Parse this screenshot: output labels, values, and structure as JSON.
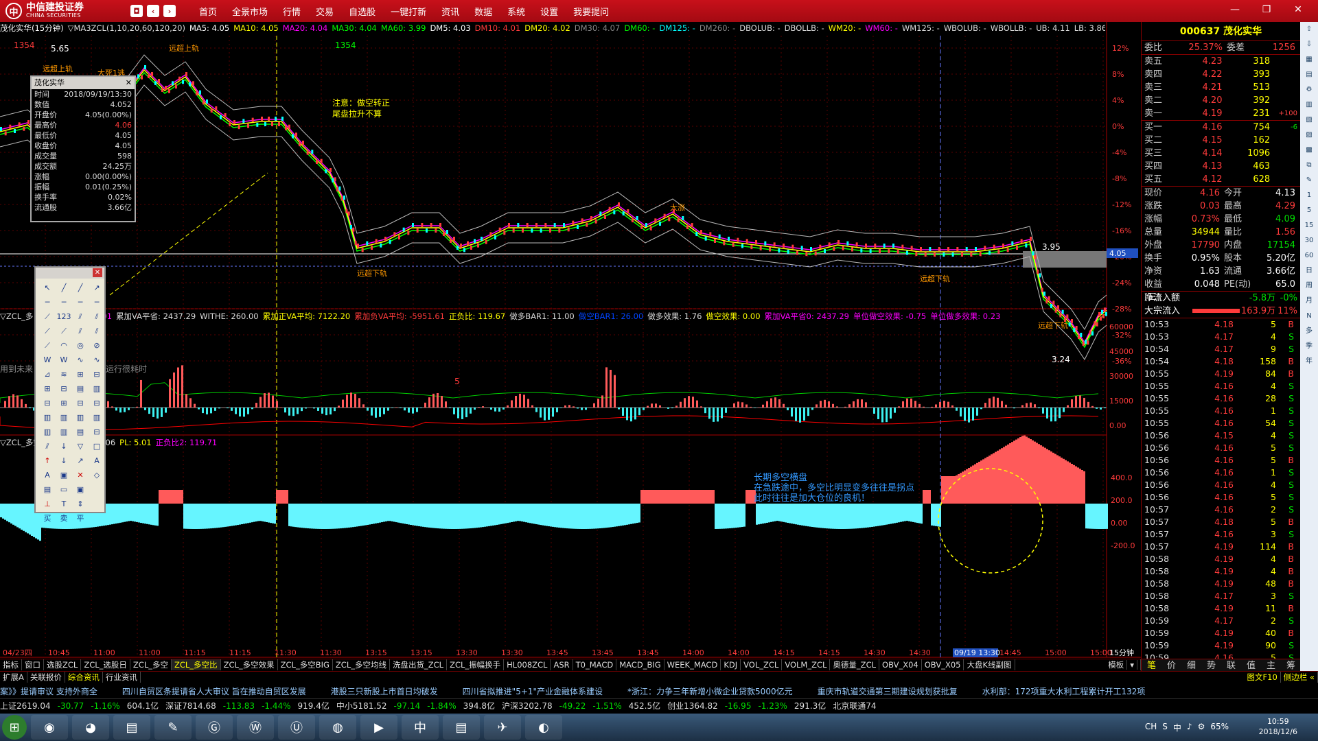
{
  "app": {
    "logo_main": "中信建投证券",
    "logo_sub": "CHINA SECURITIES",
    "menu": [
      "首页",
      "全景市场",
      "行情",
      "交易",
      "自选股",
      "一键打新",
      "资讯",
      "数据",
      "系统",
      "设置",
      "我要提问"
    ],
    "window_controls": [
      "—",
      "❐",
      "✕"
    ]
  },
  "main_chart": {
    "title_bar": [
      {
        "text": "茂化实华(15分钟)",
        "color": "#ffffff"
      },
      {
        "text": "▽MA3ZCL(1,10,20,60,120,20)",
        "color": "#dddddd"
      },
      {
        "text": "MA5: 4.05",
        "color": "#ffffff"
      },
      {
        "text": "MA10: 4.05",
        "color": "#ffff00"
      },
      {
        "text": "MA20: 4.04",
        "color": "#ff00ff"
      },
      {
        "text": "MA30: 4.04",
        "color": "#00ff00"
      },
      {
        "text": "MA60: 3.99",
        "color": "#00ff00"
      },
      {
        "text": "DM5: 4.03",
        "color": "#ffffff"
      },
      {
        "text": "DM10: 4.01",
        "color": "#ff3b3b"
      },
      {
        "text": "DM20: 4.02",
        "color": "#ffff00"
      },
      {
        "text": "DM30: 4.07",
        "color": "#888888"
      },
      {
        "text": "DM60: -",
        "color": "#00ff00"
      },
      {
        "text": "DM125: -",
        "color": "#00ffff"
      },
      {
        "text": "DM260: -",
        "color": "#888888"
      },
      {
        "text": "DBOLUB: -",
        "color": "#dddddd"
      },
      {
        "text": "DBOLLB: -",
        "color": "#dddddd"
      },
      {
        "text": "WM20: -",
        "color": "#ffff00"
      },
      {
        "text": "WM60: -",
        "color": "#ff00ff"
      },
      {
        "text": "WM125: -",
        "color": "#dddddd"
      },
      {
        "text": "WBOLUB: -",
        "color": "#dddddd"
      },
      {
        "text": "WBOLLB: -",
        "color": "#dddddd"
      },
      {
        "text": "UB: 4.11",
        "color": "#dddddd"
      },
      {
        "text": "LB: 3.86",
        "color": "#dddddd"
      },
      {
        "text": "远超上轨应",
        "color": "#ffff00"
      }
    ],
    "y_axis_pct": [
      "12%",
      "8%",
      "4%",
      "0%",
      "-4%",
      "-8%",
      "-12%",
      "-16%",
      "-20%",
      "-24%",
      "-28%",
      "-32%",
      "-36%"
    ],
    "price_labels": {
      "high": "5.65",
      "low": "3.24",
      "right_mark": "3.95",
      "current": "4.05",
      "count1": "1354",
      "count2": "1354"
    },
    "annotations": {
      "note1": "注意：做空转正",
      "note2": "尾盘拉升不算",
      "overlay_left": "用到未来",
      "overlay_right": "运行很耗时",
      "marker": "5"
    },
    "signal_labels": [
      "远超上轨",
      "远超上轨",
      "大死1逃",
      "远超下轨",
      "远超下轨",
      "大涨",
      "远超下轨"
    ]
  },
  "indicator1": {
    "title_bar": [
      {
        "text": "▽ZCL_多",
        "color": "#dddddd"
      },
      {
        "text": "均价: 4.06",
        "color": "#ffff00"
      },
      {
        "text": "PL: 5.01",
        "color": "#ff00ff"
      },
      {
        "text": "累加VA平省: 2437.29",
        "color": "#dddddd"
      },
      {
        "text": "WITHE: 260.00",
        "color": "#dddddd"
      },
      {
        "text": "累加正VA平均: 7122.20",
        "color": "#ffff00"
      },
      {
        "text": "累加负VA平均: -5951.61",
        "color": "#ff3b3b"
      },
      {
        "text": "正负比: 119.67",
        "color": "#ffff00"
      },
      {
        "text": "做多BAR1: 11.00",
        "color": "#dddddd"
      },
      {
        "text": "做空BAR1: 26.00",
        "color": "#0044ff"
      },
      {
        "text": "做多效果: 1.76",
        "color": "#dddddd"
      },
      {
        "text": "做空效果: 0.00",
        "color": "#ffff00"
      },
      {
        "text": "累加VA平省0: 2437.29",
        "color": "#ff00ff"
      },
      {
        "text": "单位做空效果: -0.75",
        "color": "#ff00ff"
      },
      {
        "text": "单位做多效果: 0.23",
        "color": "#ff00ff"
      }
    ],
    "y_axis": [
      "60000",
      "45000",
      "30000",
      "15000",
      "0.00"
    ]
  },
  "indicator2": {
    "title_bar": [
      {
        "text": "▽ZCL_多空比(1,10)",
        "color": "#dddddd"
      },
      {
        "text": "均价: 4.06",
        "color": "#dddddd"
      },
      {
        "text": "PL: 5.01",
        "color": "#ffff00"
      },
      {
        "text": "正负比2: 119.71",
        "color": "#ff00ff"
      }
    ],
    "y_axis": [
      "400.0",
      "200.0",
      "0.00",
      "-200.0"
    ],
    "note_lines": [
      "长期多空横盘",
      "在急跌途中，多空比明显变多往往是拐点",
      "此时往往是加大仓位的良机！"
    ]
  },
  "time_axis": [
    "04/23四",
    "10:45",
    "11:00",
    "11:00",
    "11:15",
    "11:15",
    "11:30",
    "11:30",
    "13:15",
    "13:15",
    "13:30",
    "13:30",
    "13:45",
    "13:45",
    "13:45",
    "14:00",
    "14:00",
    "14:15",
    "14:15",
    "14:30",
    "14:30",
    "09/19 13:30",
    "14:45",
    "15:00",
    "15:00"
  ],
  "period_label": "15分钟",
  "infowin": {
    "title": "茂化实华",
    "rows": [
      {
        "k": "时间",
        "v": "2018/09/19/13:30",
        "color": "#dddddd"
      },
      {
        "k": "数值",
        "v": "4.052",
        "color": "#dddddd"
      },
      {
        "k": "开盘价",
        "v": "4.05(0.00%)",
        "color": "#dddddd"
      },
      {
        "k": "最高价",
        "v": "4.06",
        "color": "#ff3b3b"
      },
      {
        "k": "最低价",
        "v": "4.05",
        "color": "#dddddd"
      },
      {
        "k": "收盘价",
        "v": "4.05",
        "color": "#dddddd"
      },
      {
        "k": "成交量",
        "v": "598",
        "color": "#dddddd"
      },
      {
        "k": "成交额",
        "v": "24.25万",
        "color": "#dddddd"
      },
      {
        "k": "涨幅",
        "v": "0.00(0.00%)",
        "color": "#dddddd"
      },
      {
        "k": "振幅",
        "v": "0.01(0.25%)",
        "color": "#dddddd"
      },
      {
        "k": "换手率",
        "v": "0.02%",
        "color": "#dddddd"
      },
      {
        "k": "流通股",
        "v": "3.66亿",
        "color": "#dddddd"
      }
    ]
  },
  "toolwin": {
    "tools": [
      "↖",
      "╱",
      "╱",
      "↗",
      "─",
      "─",
      "─",
      "─",
      "⟋",
      "123",
      "⫽",
      "⫽",
      "⟋",
      "⟋",
      "⫽",
      "⫽",
      "⟋",
      "◠",
      "◎",
      "⊘",
      "W",
      "W",
      "∿",
      "∿",
      "⊿",
      "≋",
      "⊞",
      "⊟",
      "⊞",
      "⊟",
      "▤",
      "▥",
      "⊟",
      "⊞",
      "⊟",
      "⊟",
      "▥",
      "▥",
      "▥",
      "▥",
      "▥",
      "▥",
      "▤",
      "⊟",
      "⫽",
      "↓",
      "▽",
      "□",
      "↑",
      "↓",
      "↗",
      "A",
      "A",
      "▣",
      "✕",
      "◇",
      "▤",
      "▭",
      "▣",
      "",
      "⊥",
      "T",
      "⇕",
      "",
      "买",
      "卖",
      "平",
      ""
    ]
  },
  "quote": {
    "code_name": "000637 茂化实华",
    "weibi": {
      "label": "委比",
      "pct": "25.37%",
      "diff_label": "委差",
      "diff": "1256"
    },
    "asks": [
      {
        "label": "卖五",
        "price": "4.23",
        "vol": "318",
        "extra": ""
      },
      {
        "label": "卖四",
        "price": "4.22",
        "vol": "393",
        "extra": ""
      },
      {
        "label": "卖三",
        "price": "4.21",
        "vol": "513",
        "extra": ""
      },
      {
        "label": "卖二",
        "price": "4.20",
        "vol": "392",
        "extra": ""
      },
      {
        "label": "卖一",
        "price": "4.19",
        "vol": "231",
        "extra": "+100"
      }
    ],
    "bids": [
      {
        "label": "买一",
        "price": "4.16",
        "vol": "754",
        "extra": "-6"
      },
      {
        "label": "买二",
        "price": "4.15",
        "vol": "162",
        "extra": ""
      },
      {
        "label": "买三",
        "price": "4.14",
        "vol": "1096",
        "extra": ""
      },
      {
        "label": "买四",
        "price": "4.13",
        "vol": "463",
        "extra": ""
      },
      {
        "label": "买五",
        "price": "4.12",
        "vol": "628",
        "extra": ""
      }
    ],
    "stats": [
      {
        "a": "现价",
        "b": "4.16",
        "bc": "#ff3b3b",
        "c": "今开",
        "d": "4.13",
        "dc": "#ffffff"
      },
      {
        "a": "涨跌",
        "b": "0.03",
        "bc": "#ff3b3b",
        "c": "最高",
        "d": "4.29",
        "dc": "#ff3b3b"
      },
      {
        "a": "涨幅",
        "b": "0.73%",
        "bc": "#ff3b3b",
        "c": "最低",
        "d": "4.09",
        "dc": "#00e000"
      },
      {
        "a": "总量",
        "b": "34944",
        "bc": "#ffff00",
        "c": "量比",
        "d": "1.56",
        "dc": "#ff3b3b"
      },
      {
        "a": "外盘",
        "b": "17790",
        "bc": "#ff3b3b",
        "c": "内盘",
        "d": "17154",
        "dc": "#00e000"
      },
      {
        "a": "换手",
        "b": "0.95%",
        "bc": "#ffffff",
        "c": "股本",
        "d": "5.20亿",
        "dc": "#ffffff"
      },
      {
        "a": "净资",
        "b": "1.63",
        "bc": "#ffffff",
        "c": "流通",
        "d": "3.66亿",
        "dc": "#ffffff"
      },
      {
        "a": "收益(三)",
        "b": "0.048",
        "bc": "#ffffff",
        "c": "PE(动)",
        "d": "65.0",
        "dc": "#ffffff"
      }
    ],
    "flow": [
      {
        "label": "净流入额",
        "value": "-5.8万",
        "pct": "-0%",
        "vc": "#00e000"
      },
      {
        "label": "大宗流入",
        "value": "163.9万",
        "pct": "11%",
        "vc": "#ff3b3b"
      }
    ],
    "ticks": [
      {
        "t": "10:53",
        "p": "4.18",
        "pc": "#ff3b3b",
        "v": "5",
        "s": "B",
        "sc": "#ff3b3b"
      },
      {
        "t": "10:53",
        "p": "4.17",
        "pc": "#ff3b3b",
        "v": "4",
        "s": "S",
        "sc": "#00e000"
      },
      {
        "t": "10:54",
        "p": "4.17",
        "pc": "#ff3b3b",
        "v": "9",
        "s": "S",
        "sc": "#00e000"
      },
      {
        "t": "10:54",
        "p": "4.18",
        "pc": "#ff3b3b",
        "v": "158",
        "s": "B",
        "sc": "#ff3b3b"
      },
      {
        "t": "10:55",
        "p": "4.19",
        "pc": "#ff3b3b",
        "v": "84",
        "s": "B",
        "sc": "#ff3b3b"
      },
      {
        "t": "10:55",
        "p": "4.16",
        "pc": "#ff3b3b",
        "v": "4",
        "s": "S",
        "sc": "#00e000"
      },
      {
        "t": "10:55",
        "p": "4.16",
        "pc": "#ff3b3b",
        "v": "28",
        "s": "S",
        "sc": "#00e000"
      },
      {
        "t": "10:55",
        "p": "4.16",
        "pc": "#ff3b3b",
        "v": "1",
        "s": "S",
        "sc": "#00e000"
      },
      {
        "t": "10:55",
        "p": "4.16",
        "pc": "#ff3b3b",
        "v": "54",
        "s": "S",
        "sc": "#00e000"
      },
      {
        "t": "10:56",
        "p": "4.15",
        "pc": "#ff3b3b",
        "v": "4",
        "s": "S",
        "sc": "#00e000"
      },
      {
        "t": "10:56",
        "p": "4.16",
        "pc": "#ff3b3b",
        "v": "5",
        "s": "S",
        "sc": "#00e000"
      },
      {
        "t": "10:56",
        "p": "4.16",
        "pc": "#ff3b3b",
        "v": "5",
        "s": "B",
        "sc": "#ff3b3b"
      },
      {
        "t": "10:56",
        "p": "4.16",
        "pc": "#ff3b3b",
        "v": "1",
        "s": "S",
        "sc": "#00e000"
      },
      {
        "t": "10:56",
        "p": "4.16",
        "pc": "#ff3b3b",
        "v": "4",
        "s": "S",
        "sc": "#00e000"
      },
      {
        "t": "10:56",
        "p": "4.16",
        "pc": "#ff3b3b",
        "v": "5",
        "s": "S",
        "sc": "#00e000"
      },
      {
        "t": "10:57",
        "p": "4.16",
        "pc": "#ff3b3b",
        "v": "2",
        "s": "S",
        "sc": "#00e000"
      },
      {
        "t": "10:57",
        "p": "4.18",
        "pc": "#ff3b3b",
        "v": "5",
        "s": "B",
        "sc": "#ff3b3b"
      },
      {
        "t": "10:57",
        "p": "4.16",
        "pc": "#ff3b3b",
        "v": "3",
        "s": "S",
        "sc": "#00e000"
      },
      {
        "t": "10:57",
        "p": "4.19",
        "pc": "#ff3b3b",
        "v": "114",
        "s": "B",
        "sc": "#ff3b3b"
      },
      {
        "t": "10:58",
        "p": "4.19",
        "pc": "#ff3b3b",
        "v": "4",
        "s": "B",
        "sc": "#ff3b3b"
      },
      {
        "t": "10:58",
        "p": "4.19",
        "pc": "#ff3b3b",
        "v": "4",
        "s": "B",
        "sc": "#ff3b3b"
      },
      {
        "t": "10:58",
        "p": "4.19",
        "pc": "#ff3b3b",
        "v": "48",
        "s": "B",
        "sc": "#ff3b3b"
      },
      {
        "t": "10:58",
        "p": "4.17",
        "pc": "#ff3b3b",
        "v": "3",
        "s": "S",
        "sc": "#00e000"
      },
      {
        "t": "10:58",
        "p": "4.19",
        "pc": "#ff3b3b",
        "v": "11",
        "s": "B",
        "sc": "#ff3b3b"
      },
      {
        "t": "10:59",
        "p": "4.17",
        "pc": "#ff3b3b",
        "v": "2",
        "s": "S",
        "sc": "#00e000"
      },
      {
        "t": "10:59",
        "p": "4.19",
        "pc": "#ff3b3b",
        "v": "40",
        "s": "B",
        "sc": "#ff3b3b"
      },
      {
        "t": "10:59",
        "p": "4.19",
        "pc": "#ff3b3b",
        "v": "90",
        "s": "S",
        "sc": "#00e000"
      },
      {
        "t": "10:59",
        "p": "4.16",
        "pc": "#ff3b3b",
        "v": "5",
        "s": "S",
        "sc": "#00e000"
      }
    ],
    "bottom_tabs": [
      "笔",
      "价",
      "细",
      "势",
      "联",
      "值",
      "主",
      "筹"
    ]
  },
  "icon_strip": [
    "⇧",
    "⇩",
    "▦",
    "▤",
    "⚙",
    "▥",
    "▧",
    "▨",
    "▩",
    "⧉",
    "✎",
    "1",
    "5",
    "15",
    "30",
    "60",
    "日",
    "周",
    "月",
    "N",
    "多",
    "季",
    "年"
  ],
  "tabs_row1": [
    "指标",
    "窗口",
    "选股ZCL",
    "ZCL_选股日",
    "ZCL_多空",
    "ZCL_多空比",
    "ZCL_多空效果",
    "ZCL_多空BIG",
    "ZCL_多空均线",
    "洗盘出货_ZCL",
    "ZCL_振幅换手",
    "HL008ZCL",
    "ASR",
    "T0_MACD",
    "MACD_BIG",
    "WEEK_MACD",
    "KDJ",
    "VOL_ZCL",
    "VOLM_ZCL",
    "奥德量_ZCL",
    "OBV_X04",
    "OBV_X05",
    "大盘K线副图"
  ],
  "tabs_row1_active": "ZCL_多空比",
  "tabs_row1_right": [
    "模板",
    "▾"
  ],
  "tabs_row2": [
    "扩展A",
    "关联报价",
    "综合资讯",
    "行业资讯"
  ],
  "tabs_row2_right": [
    "图文F10",
    "侧边栏 «"
  ],
  "news": [
    "案》》提请审议 支持外商全",
    "四川自贸区条提请省人大审议 旨在推动自贸区发展",
    "港股三只新股上市首日均破发",
    "四川省拟推进\"5+1\"产业金融体系建设",
    "*浙江：力争三年新增小微企业贷款5000亿元",
    "重庆市轨道交通第三期建设规划获批复",
    "水利部：172项重大水利工程累计开工132项"
  ],
  "indices": [
    {
      "text": "上证2619.04",
      "color": "#dddddd"
    },
    {
      "text": "-30.77",
      "color": "#00e000"
    },
    {
      "text": "-1.16%",
      "color": "#00e000"
    },
    {
      "text": "604.1亿",
      "color": "#dddddd"
    },
    {
      "text": "深证7814.68",
      "color": "#dddddd"
    },
    {
      "text": "-113.83",
      "color": "#00e000"
    },
    {
      "text": "-1.44%",
      "color": "#00e000"
    },
    {
      "text": "919.4亿",
      "color": "#dddddd"
    },
    {
      "text": "中小5181.52",
      "color": "#dddddd"
    },
    {
      "text": "-97.14",
      "color": "#00e000"
    },
    {
      "text": "-1.84%",
      "color": "#00e000"
    },
    {
      "text": "394.8亿",
      "color": "#dddddd"
    },
    {
      "text": "沪深3202.78",
      "color": "#dddddd"
    },
    {
      "text": "-49.22",
      "color": "#00e000"
    },
    {
      "text": "-1.51%",
      "color": "#00e000"
    },
    {
      "text": "452.5亿",
      "color": "#dddddd"
    },
    {
      "text": "创业1364.82",
      "color": "#dddddd"
    },
    {
      "text": "-16.95",
      "color": "#00e000"
    },
    {
      "text": "-1.23%",
      "color": "#00e000"
    },
    {
      "text": "291.3亿",
      "color": "#dddddd"
    },
    {
      "text": "北京联通74",
      "color": "#dddddd"
    }
  ],
  "taskbar": {
    "apps": [
      "◉",
      "◕",
      "▤",
      "✎",
      "Ⓖ",
      "Ⓦ",
      "Ⓤ",
      "◍",
      "▶",
      "中",
      "▤",
      "✈",
      "◐"
    ],
    "tray": [
      "CH",
      "S",
      "中",
      "♪",
      "⚙",
      "65%"
    ],
    "time": "10:59",
    "date": "2018/12/6"
  }
}
